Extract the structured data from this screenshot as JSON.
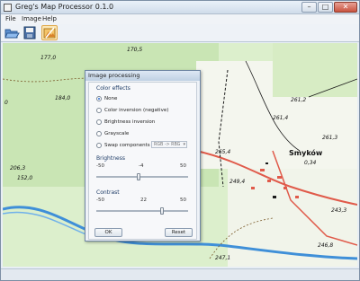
{
  "window": {
    "title": "Greg's Map Processor 0.1.0"
  },
  "menu": [
    "File",
    "Image",
    "Help"
  ],
  "toolbar": {
    "buttons": [
      "open-icon",
      "save-icon",
      "image-processing-icon"
    ]
  },
  "map": {
    "labels": [
      "0",
      "177,0",
      "184,0",
      "206,3",
      "152,0",
      "170,5",
      "Smyków",
      "0,34",
      "261,2",
      "246,8",
      "243,3",
      "247,1",
      "261,4",
      "265,4",
      "249,4",
      "261,3"
    ]
  },
  "dialog": {
    "title": "Image processing",
    "color_effects": {
      "label": "Color effects",
      "options": [
        "None",
        "Color inversion (negative)",
        "Brightness inversion",
        "Grayscale",
        "Swap components"
      ],
      "selected": "None",
      "swap_select_value": "RGB -> RBG"
    },
    "brightness": {
      "label": "Brightness",
      "min": "-50",
      "value": "-4",
      "max": "50",
      "fraction": 0.46
    },
    "contrast": {
      "label": "Contrast",
      "min": "-50",
      "value": "22",
      "max": "50",
      "fraction": 0.72
    },
    "ok_label": "OK",
    "reset_label": "Reset"
  },
  "colors": {
    "accent": "#2a6ad3",
    "water": "#3f8fd8",
    "forest": "#cfe8bd",
    "road": "#e05a4a"
  }
}
